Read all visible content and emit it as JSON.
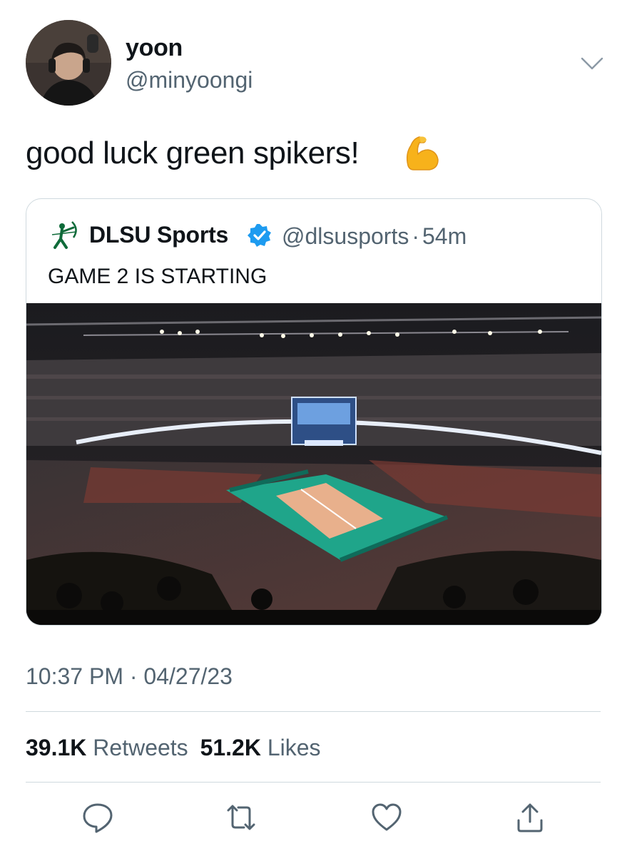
{
  "author": {
    "display_name": "yoon",
    "handle": "@minyoongi"
  },
  "tweet": {
    "text": "good luck green spikers!",
    "emoji": "flexed-biceps-icon"
  },
  "quoted_tweet": {
    "display_name": "DLSU Sports",
    "verified": true,
    "handle": "@dlsusports",
    "separator": "·",
    "time_ago": "54m",
    "text": "GAME 2 IS STARTING",
    "image": "arena-volleyball-court-photo"
  },
  "meta": {
    "timestamp": "10:37 PM · 04/27/23"
  },
  "stats": {
    "retweets_count": "39.1K",
    "retweets_label": "Retweets",
    "likes_count": "51.2K",
    "likes_label": "Likes"
  },
  "actions": [
    "reply-icon",
    "retweet-icon",
    "like-icon",
    "share-icon"
  ],
  "colors": {
    "text": "#0f1419",
    "secondary": "#536471",
    "border": "#cfd9de",
    "verified": "#1d9bf0"
  }
}
